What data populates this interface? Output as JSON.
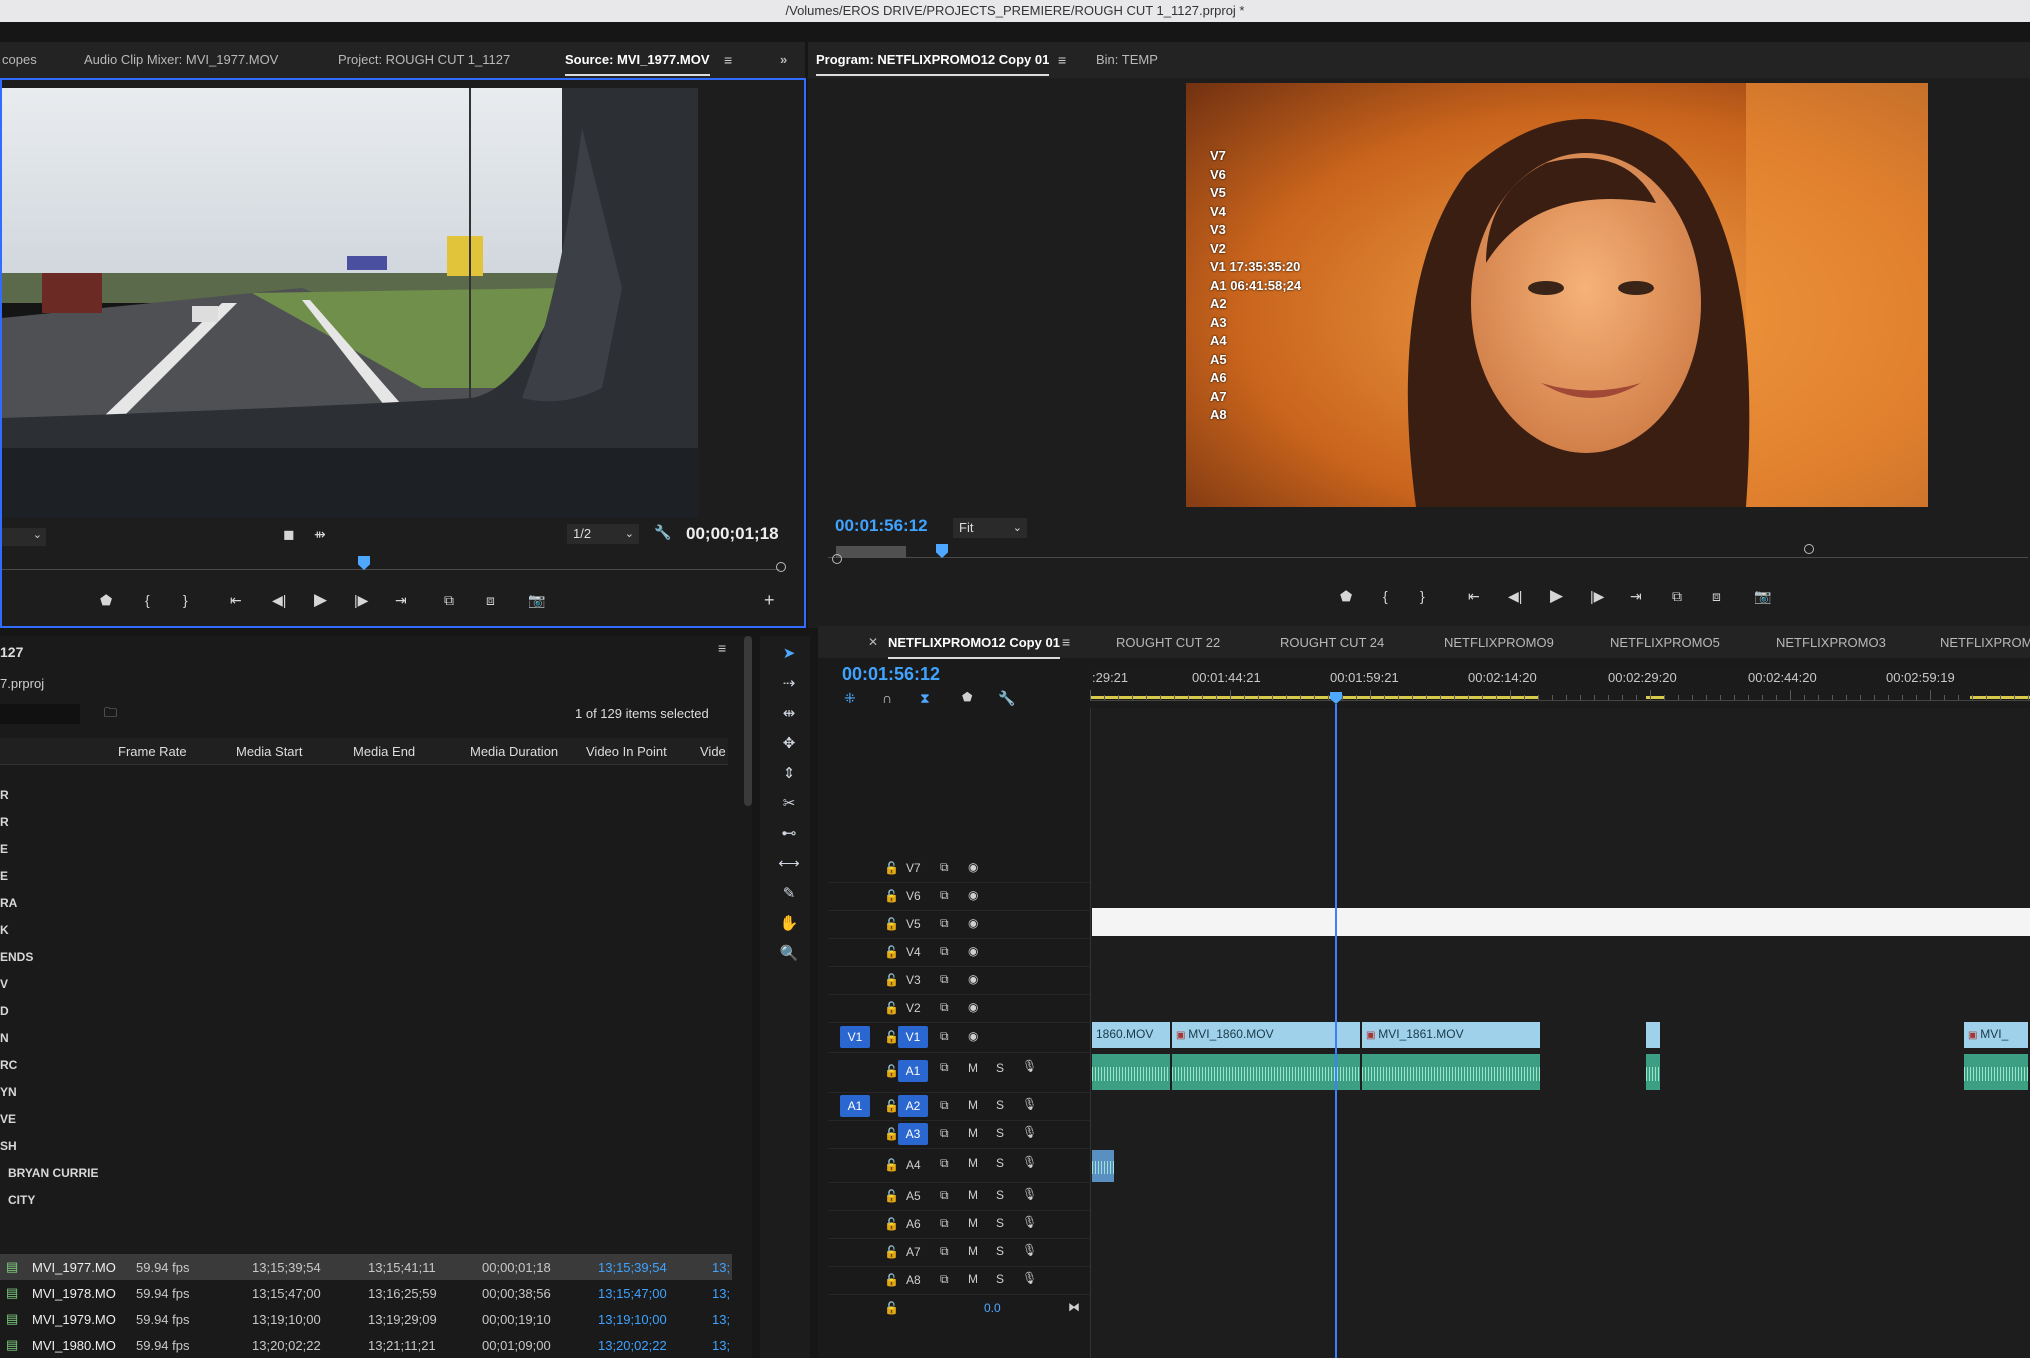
{
  "window_title": "/Volumes/EROS DRIVE/PROJECTS_PREMIERE/ROUGH CUT 1_1127.prproj *",
  "source_panel": {
    "tabs": [
      "copes",
      "Audio Clip Mixer: MVI_1977.MOV",
      "Project: ROUGH CUT 1_1127",
      "Source: MVI_1977.MOV"
    ],
    "resolution": "1/2",
    "timecode": "00;00;01;18"
  },
  "program_panel": {
    "tabs": [
      "Program: NETFLIXPROMO12 Copy 01",
      "Bin: TEMP"
    ],
    "timecode": "00:01:56:12",
    "fit": "Fit",
    "overlay_tracks": [
      "V7",
      "V6",
      "V5",
      "V4",
      "V3",
      "V2",
      "V1 17:35:35:20",
      "A1 06:41:58;24",
      "A2",
      "A3",
      "A4",
      "A5",
      "A6",
      "A7",
      "A8"
    ]
  },
  "project_panel": {
    "title": "127",
    "file": "7.prproj",
    "selection_status": "1 of 129 items selected",
    "columns": [
      "Frame Rate",
      "Media Start",
      "Media End",
      "Media Duration",
      "Video In Point",
      "Vide"
    ],
    "bins": [
      "R",
      "R",
      "E",
      "E",
      "RA",
      "K",
      "ENDS",
      "V",
      "D",
      "N",
      "RC",
      "YN",
      "VE",
      "SH",
      "BRYAN CURRIE",
      "CITY"
    ],
    "rows": [
      {
        "name": "MVI_1977.MO",
        "fps": "59.94 fps",
        "start": "13;15;39;54",
        "end": "13;15;41;11",
        "duration": "00;00;01;18",
        "in": "13;15;39;54",
        "v": "13;",
        "selected": true
      },
      {
        "name": "MVI_1978.MO",
        "fps": "59.94 fps",
        "start": "13;15;47;00",
        "end": "13;16;25;59",
        "duration": "00;00;38;56",
        "in": "13;15;47;00",
        "v": "13;",
        "selected": false
      },
      {
        "name": "MVI_1979.MO",
        "fps": "59.94 fps",
        "start": "13;19;10;00",
        "end": "13;19;29;09",
        "duration": "00;00;19;10",
        "in": "13;19;10;00",
        "v": "13;",
        "selected": false
      },
      {
        "name": "MVI_1980.MO",
        "fps": "59.94 fps",
        "start": "13;20;02;22",
        "end": "13;21;11;21",
        "duration": "00;01;09;00",
        "in": "13;20;02;22",
        "v": "13;",
        "selected": false
      }
    ]
  },
  "timeline": {
    "tabs": [
      "NETFLIXPROMO12 Copy 01",
      "ROUGHT CUT 22",
      "ROUGHT CUT 24",
      "NETFLIXPROMO9",
      "NETFLIXPROMO5",
      "NETFLIXPROMO3",
      "NETFLIXPROMC"
    ],
    "timecode": "00:01:56:12",
    "ruler": [
      ":29:21",
      "00:01:44:21",
      "00:01:59:21",
      "00:02:14:20",
      "00:02:29:20",
      "00:02:44:20",
      "00:02:59:19"
    ],
    "video_tracks": [
      "V7",
      "V6",
      "V5",
      "V4",
      "V3",
      "V2",
      "V1"
    ],
    "audio_tracks": [
      "A1",
      "A2",
      "A3",
      "A4",
      "A5",
      "A6",
      "A7",
      "A8"
    ],
    "source_patch_video": "V1",
    "source_patch_audio": "A1",
    "mute": "M",
    "solo": "S",
    "master_level": "0.0",
    "clips": [
      "1860.MOV",
      "MVI_1860.MOV",
      "MVI_1861.MOV",
      "MVI_"
    ]
  },
  "colors": {
    "accent": "#2f6cff",
    "timecode": "#3fa3ff",
    "clip_video": "#9fd2ea",
    "clip_audio": "#3c9f84"
  }
}
